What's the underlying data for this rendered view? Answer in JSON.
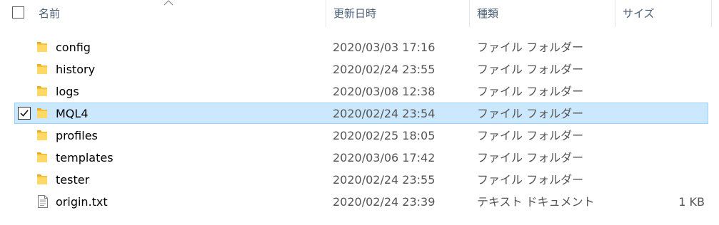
{
  "columns": {
    "name": "名前",
    "date": "更新日時",
    "type": "種類",
    "size": "サイズ"
  },
  "sort": {
    "column": "name",
    "direction": "ascending",
    "icon": "sort-up-chevron-icon"
  },
  "rows": [
    {
      "name": "config",
      "date": "2020/03/03 17:16",
      "type": "ファイル フォルダー",
      "size": "",
      "icon": "folder-icon",
      "selected": false,
      "checked": false
    },
    {
      "name": "history",
      "date": "2020/02/24 23:55",
      "type": "ファイル フォルダー",
      "size": "",
      "icon": "folder-icon",
      "selected": false,
      "checked": false
    },
    {
      "name": "logs",
      "date": "2020/03/08 12:38",
      "type": "ファイル フォルダー",
      "size": "",
      "icon": "folder-icon",
      "selected": false,
      "checked": false
    },
    {
      "name": "MQL4",
      "date": "2020/02/24 23:54",
      "type": "ファイル フォルダー",
      "size": "",
      "icon": "folder-icon",
      "selected": true,
      "checked": true
    },
    {
      "name": "profiles",
      "date": "2020/02/25 18:05",
      "type": "ファイル フォルダー",
      "size": "",
      "icon": "folder-icon",
      "selected": false,
      "checked": false
    },
    {
      "name": "templates",
      "date": "2020/03/06 17:42",
      "type": "ファイル フォルダー",
      "size": "",
      "icon": "folder-icon",
      "selected": false,
      "checked": false
    },
    {
      "name": "tester",
      "date": "2020/02/24 23:55",
      "type": "ファイル フォルダー",
      "size": "",
      "icon": "folder-icon",
      "selected": false,
      "checked": false
    },
    {
      "name": "origin.txt",
      "date": "2020/02/24 23:39",
      "type": "テキスト ドキュメント",
      "size": "1 KB",
      "icon": "text-document-icon",
      "selected": false,
      "checked": false
    }
  ],
  "colors": {
    "selection_bg": "#cce8ff",
    "selection_border": "#99d1ff",
    "header_text": "#4c607a",
    "folder_yellow": "#ffd865"
  }
}
